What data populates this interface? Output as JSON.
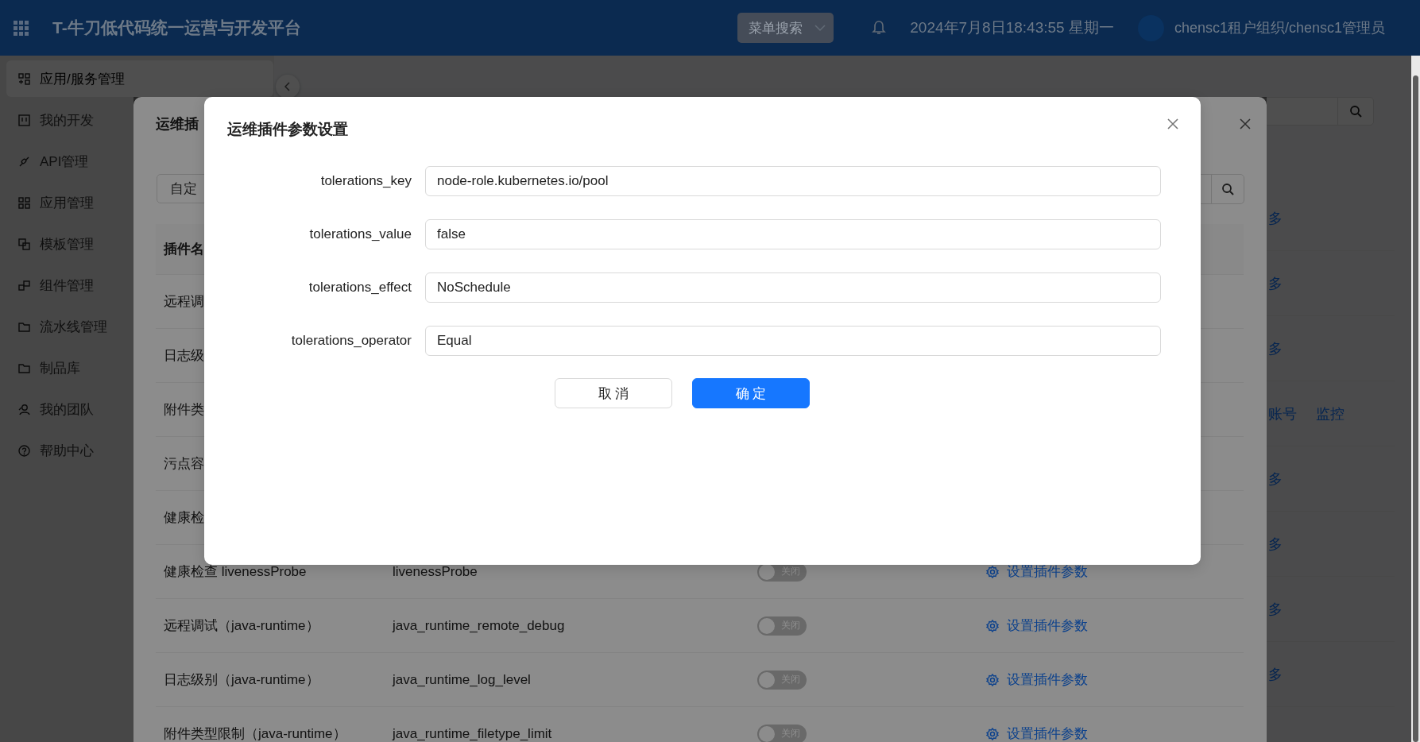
{
  "header": {
    "title": "T-牛刀低代码统一运营与开发平台",
    "menu_search": {
      "placeholder": "菜单搜索"
    },
    "datetime": "2024年7月8日18:43:55 星期一",
    "user": "chensc1租户组织/chensc1管理员"
  },
  "sidebar": {
    "items": [
      {
        "label": "应用/服务管理",
        "selected": true
      },
      {
        "label": "我的开发",
        "selected": false
      },
      {
        "label": "API管理",
        "selected": false
      },
      {
        "label": "应用管理",
        "selected": false
      },
      {
        "label": "模板管理",
        "selected": false
      },
      {
        "label": "组件管理",
        "selected": false
      },
      {
        "label": "流水线管理",
        "selected": false
      },
      {
        "label": "制品库",
        "selected": false
      },
      {
        "label": "我的团队",
        "selected": false
      },
      {
        "label": "帮助中心",
        "selected": false
      }
    ]
  },
  "background_page": {
    "rows": [
      {
        "actions": [
          "多"
        ]
      },
      {
        "actions": [
          "多"
        ]
      },
      {
        "actions": [
          "多"
        ]
      },
      {
        "actions": [
          "账号",
          "监控"
        ]
      },
      {
        "actions": [
          "多"
        ]
      },
      {
        "actions": [
          "多"
        ]
      },
      {
        "actions": [
          "多"
        ]
      },
      {
        "actions": [
          "多"
        ]
      }
    ]
  },
  "plugin_dialog": {
    "title": "运维插",
    "filter_button": "自定",
    "columns": [
      "插件名"
    ],
    "rows": [
      {
        "name": "远程调"
      },
      {
        "name": "日志级"
      },
      {
        "name": "附件类"
      },
      {
        "name": "污点容"
      },
      {
        "name": "健康检"
      },
      {
        "name": "健康检查 livenessProbe",
        "key": "livenessProbe",
        "switch": {
          "on": false,
          "label": "关闭"
        },
        "action": "设置插件参数"
      },
      {
        "name": "远程调试（java-runtime）",
        "key": "java_runtime_remote_debug",
        "switch": {
          "on": false,
          "label": "关闭"
        },
        "action": "设置插件参数"
      },
      {
        "name": "日志级别（java-runtime）",
        "key": "java_runtime_log_level",
        "switch": {
          "on": false,
          "label": "关闭"
        },
        "action": "设置插件参数"
      },
      {
        "name": "附件类型限制（java-runtime）",
        "key": "java_runtime_filetype_limit",
        "switch": {
          "on": false,
          "label": "关闭"
        },
        "action": "设置插件参数"
      }
    ]
  },
  "param_dialog": {
    "title": "运维插件参数设置",
    "fields": [
      {
        "label": "tolerations_key",
        "value": "node-role.kubernetes.io/pool"
      },
      {
        "label": "tolerations_value",
        "value": "false"
      },
      {
        "label": "tolerations_effect",
        "value": "NoSchedule"
      },
      {
        "label": "tolerations_operator",
        "value": "Equal"
      }
    ],
    "buttons": [
      {
        "label": "取 消",
        "kind": "default"
      },
      {
        "label": "确 定",
        "kind": "primary"
      }
    ]
  }
}
